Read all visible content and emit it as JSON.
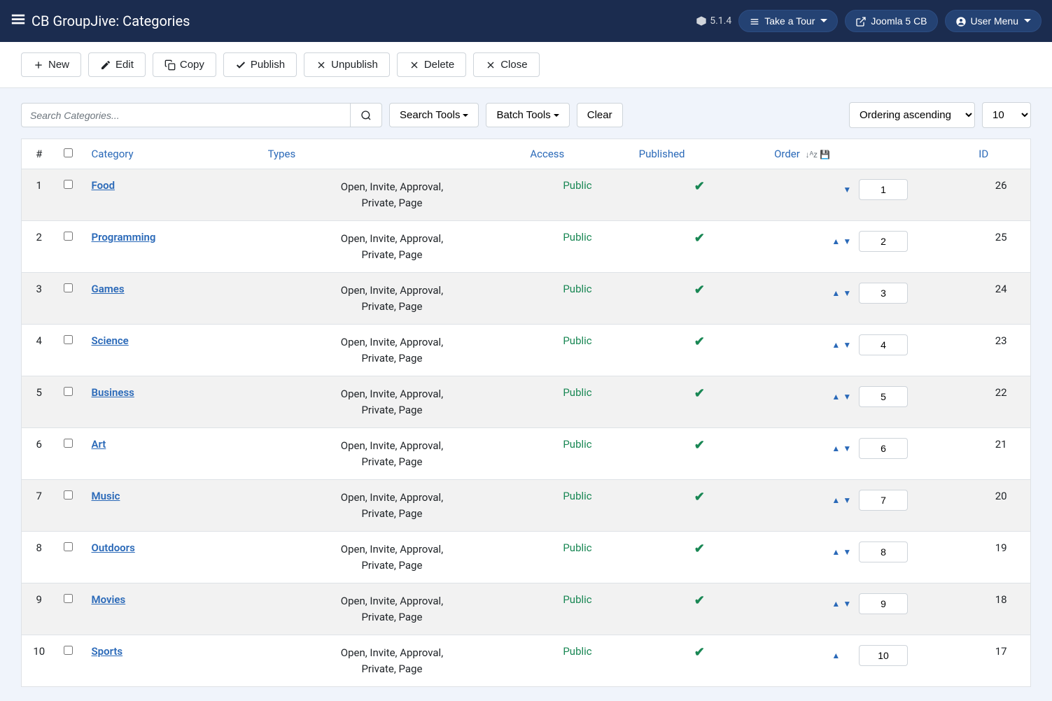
{
  "header": {
    "title": "CB GroupJive: Categories",
    "version": "5.1.4",
    "take_tour": "Take a Tour",
    "site_link": "Joomla 5 CB",
    "user_menu": "User Menu"
  },
  "toolbar": {
    "new": "New",
    "edit": "Edit",
    "copy": "Copy",
    "publish": "Publish",
    "unpublish": "Unpublish",
    "delete": "Delete",
    "close": "Close"
  },
  "filters": {
    "search_placeholder": "Search Categories...",
    "search_tools": "Search Tools",
    "batch_tools": "Batch Tools",
    "clear": "Clear",
    "ordering": "Ordering ascending",
    "limit": "10"
  },
  "columns": {
    "num": "#",
    "category": "Category",
    "types": "Types",
    "access": "Access",
    "published": "Published",
    "order": "Order",
    "id": "ID"
  },
  "rows": [
    {
      "num": "1",
      "category": "Food",
      "types": "Open, Invite, Approval, Private, Page",
      "access": "Public",
      "order": "1",
      "id": "26",
      "first": true,
      "last": false
    },
    {
      "num": "2",
      "category": "Programming",
      "types": "Open, Invite, Approval, Private, Page",
      "access": "Public",
      "order": "2",
      "id": "25",
      "first": false,
      "last": false
    },
    {
      "num": "3",
      "category": "Games",
      "types": "Open, Invite, Approval, Private, Page",
      "access": "Public",
      "order": "3",
      "id": "24",
      "first": false,
      "last": false
    },
    {
      "num": "4",
      "category": "Science",
      "types": "Open, Invite, Approval, Private, Page",
      "access": "Public",
      "order": "4",
      "id": "23",
      "first": false,
      "last": false
    },
    {
      "num": "5",
      "category": "Business",
      "types": "Open, Invite, Approval, Private, Page",
      "access": "Public",
      "order": "5",
      "id": "22",
      "first": false,
      "last": false
    },
    {
      "num": "6",
      "category": "Art",
      "types": "Open, Invite, Approval, Private, Page",
      "access": "Public",
      "order": "6",
      "id": "21",
      "first": false,
      "last": false
    },
    {
      "num": "7",
      "category": "Music",
      "types": "Open, Invite, Approval, Private, Page",
      "access": "Public",
      "order": "7",
      "id": "20",
      "first": false,
      "last": false
    },
    {
      "num": "8",
      "category": "Outdoors",
      "types": "Open, Invite, Approval, Private, Page",
      "access": "Public",
      "order": "8",
      "id": "19",
      "first": false,
      "last": false
    },
    {
      "num": "9",
      "category": "Movies",
      "types": "Open, Invite, Approval, Private, Page",
      "access": "Public",
      "order": "9",
      "id": "18",
      "first": false,
      "last": false
    },
    {
      "num": "10",
      "category": "Sports",
      "types": "Open, Invite, Approval, Private, Page",
      "access": "Public",
      "order": "10",
      "id": "17",
      "first": false,
      "last": true
    }
  ]
}
